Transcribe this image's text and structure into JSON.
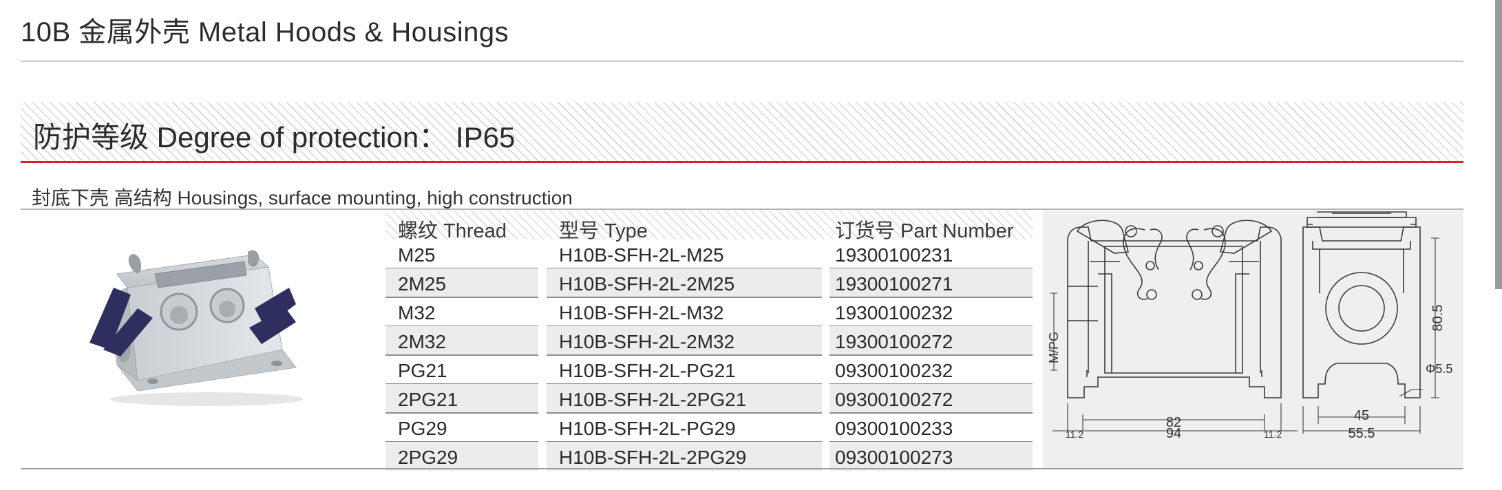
{
  "header": {
    "title": "10B 金属外壳 Metal Hoods & Housings"
  },
  "protection": {
    "label": "防护等级 Degree of protection： IP65"
  },
  "section": {
    "subtitle": "封底下壳 高结构 Housings, surface mounting, high construction"
  },
  "table": {
    "headers": {
      "thread": "螺纹 Thread",
      "type": "型号 Type",
      "part_number": "订货号 Part Number"
    },
    "rows": [
      {
        "thread": "M25",
        "type": "H10B-SFH-2L-M25",
        "part_number": "19300100231"
      },
      {
        "thread": "2M25",
        "type": "H10B-SFH-2L-2M25",
        "part_number": "19300100271"
      },
      {
        "thread": "M32",
        "type": "H10B-SFH-2L-M32",
        "part_number": "19300100232"
      },
      {
        "thread": "2M32",
        "type": "H10B-SFH-2L-2M32",
        "part_number": "19300100272"
      },
      {
        "thread": "PG21",
        "type": "H10B-SFH-2L-PG21",
        "part_number": "09300100232"
      },
      {
        "thread": "2PG21",
        "type": "H10B-SFH-2L-2PG21",
        "part_number": "09300100272"
      },
      {
        "thread": "PG29",
        "type": "H10B-SFH-2L-PG29",
        "part_number": "09300100233"
      },
      {
        "thread": "2PG29",
        "type": "H10B-SFH-2L-2PG29",
        "part_number": "09300100273"
      }
    ]
  },
  "drawing": {
    "thread_label": "M/PG",
    "dim_82": "82",
    "dim_94": "94",
    "dim_11_2_left": "11.2",
    "dim_11_2_right": "11.2",
    "dim_80_5": "80.5",
    "dim_phi": "Φ5.5",
    "dim_45": "45",
    "dim_55_5": "55.5"
  },
  "colors": {
    "accent_red": "#d8232a",
    "rule_gray": "#b3b3b3",
    "panel_gray": "#efefef",
    "latch_blue": "#2e2f5e"
  }
}
